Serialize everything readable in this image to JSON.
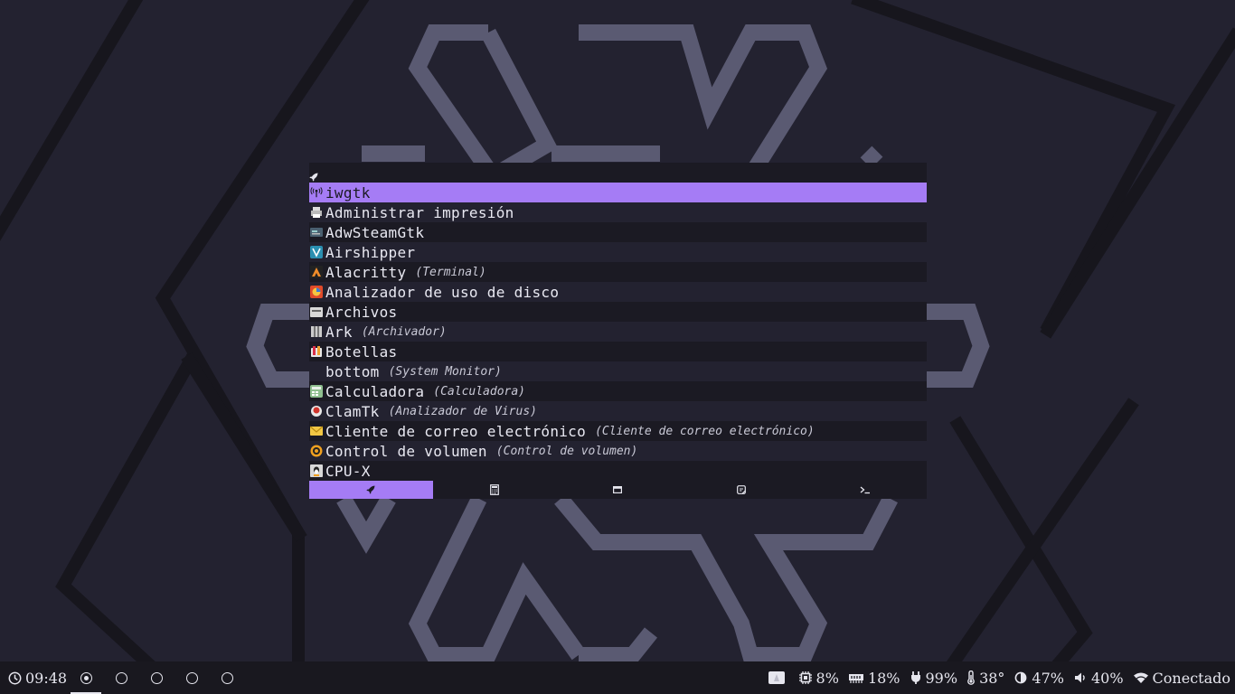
{
  "launcher": {
    "prompt_placeholder": "",
    "items": [
      {
        "name": "iwgtk",
        "desc": "",
        "icon": "antenna-icon",
        "selected": true
      },
      {
        "name": "Administrar impresión",
        "desc": "",
        "icon": "printer-icon"
      },
      {
        "name": "AdwSteamGtk",
        "desc": "",
        "icon": "adwsteamgtk-icon"
      },
      {
        "name": "Airshipper",
        "desc": "",
        "icon": "airshipper-icon"
      },
      {
        "name": "Alacritty",
        "desc": "(Terminal)",
        "icon": "alacritty-icon"
      },
      {
        "name": "Analizador de uso de disco",
        "desc": "",
        "icon": "disk-usage-icon"
      },
      {
        "name": "Archivos",
        "desc": "",
        "icon": "files-icon"
      },
      {
        "name": "Ark",
        "desc": "(Archivador)",
        "icon": "ark-icon"
      },
      {
        "name": "Botellas",
        "desc": "",
        "icon": "bottles-icon"
      },
      {
        "name": "bottom",
        "desc": "(System Monitor)",
        "icon": "none"
      },
      {
        "name": "Calculadora",
        "desc": "(Calculadora)",
        "icon": "calculator-app-icon"
      },
      {
        "name": "ClamTk",
        "desc": "(Analizador de Virus)",
        "icon": "clamtk-icon"
      },
      {
        "name": "Cliente de correo electrónico",
        "desc": "(Cliente de correo electrónico)",
        "icon": "mail-icon"
      },
      {
        "name": "Control de volumen",
        "desc": "(Control de volumen)",
        "icon": "volume-control-icon"
      },
      {
        "name": "CPU-X",
        "desc": "",
        "icon": "cpu-x-icon"
      }
    ],
    "modes": [
      {
        "name": "drun",
        "icon": "rocket-icon",
        "active": true
      },
      {
        "name": "calc",
        "icon": "calculator-icon",
        "active": false
      },
      {
        "name": "window",
        "icon": "window-icon",
        "active": false
      },
      {
        "name": "clipboard",
        "icon": "clipboard-icon",
        "active": false
      },
      {
        "name": "run",
        "icon": "terminal-icon",
        "active": false
      }
    ]
  },
  "bar": {
    "time": "09:48",
    "workspaces": [
      {
        "id": 1,
        "active": true
      },
      {
        "id": 2,
        "active": false
      },
      {
        "id": 3,
        "active": false
      },
      {
        "id": 4,
        "active": false
      },
      {
        "id": 5,
        "active": false
      }
    ],
    "cpu": "8%",
    "memory": "18%",
    "battery": "99%",
    "temperature": "38°",
    "brightness": "47%",
    "volume": "40%",
    "network": "Conectado"
  },
  "colors": {
    "accent": "#a57cf5",
    "background": "#232230",
    "panel": "#1b1a23",
    "wallpaper_lines": "#5a5a72"
  }
}
